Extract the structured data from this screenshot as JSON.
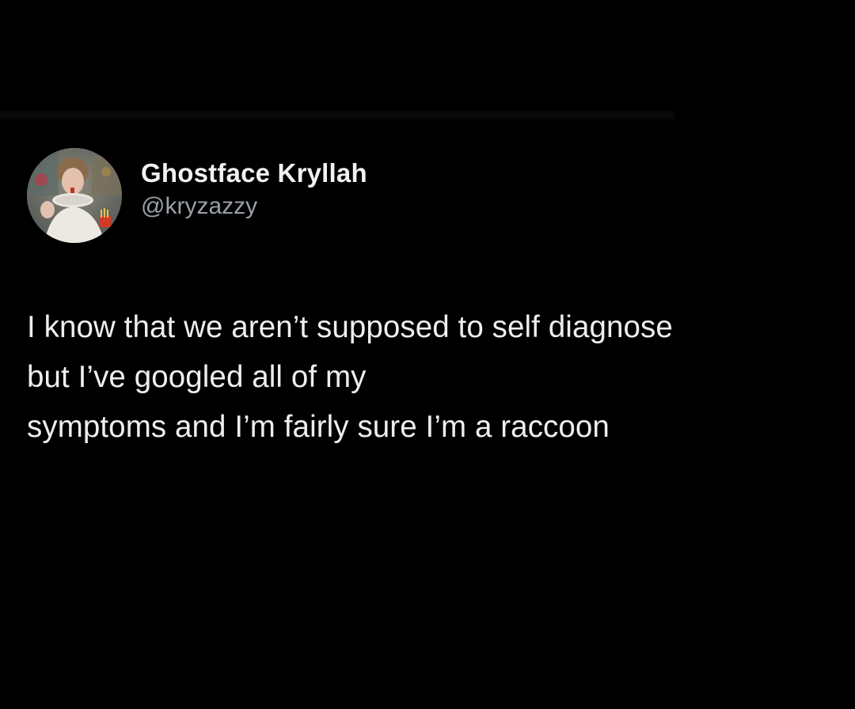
{
  "tweet": {
    "author": {
      "display_name": "Ghostface Kryllah",
      "handle": "@kryzazzy",
      "avatar": "profile-photo-avatar"
    },
    "text_lines": [
      "I know that we aren’t supposed to self diagnose",
      "but I’ve googled all of my",
      "symptoms and I’m fairly sure I’m a raccoon"
    ]
  },
  "colors": {
    "background": "#000000",
    "name_text": "#f2f2f2",
    "handle_text": "#9aa0a6",
    "body_text": "#eeeeee"
  }
}
